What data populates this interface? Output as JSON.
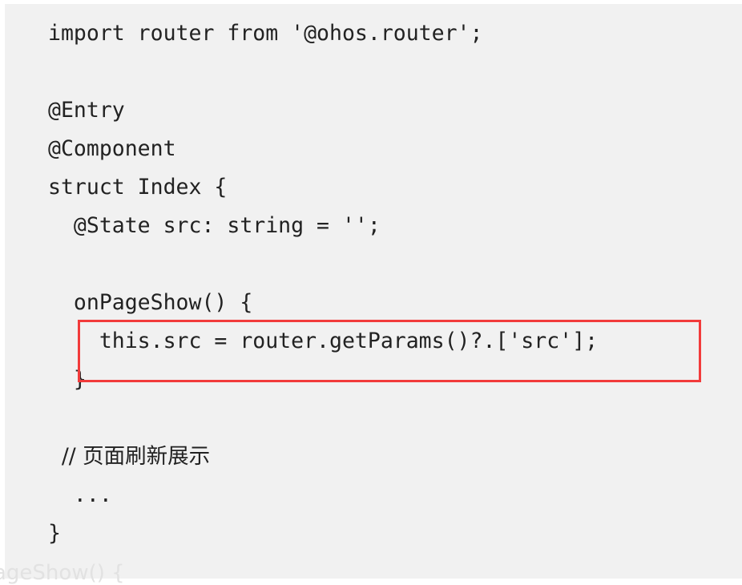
{
  "code_lines": [
    "import router from '@ohos.router';",
    "",
    "@Entry",
    "@Component",
    "struct Index {",
    "  @State src: string = '';",
    "",
    "  onPageShow() {",
    "    this.src = router.getParams()?.['src'];",
    "  }",
    "",
    "  // 页面刷新展示",
    "  ...",
    "}"
  ],
  "background_text": "ageShow() {",
  "highlight_color": "#f23b3b"
}
